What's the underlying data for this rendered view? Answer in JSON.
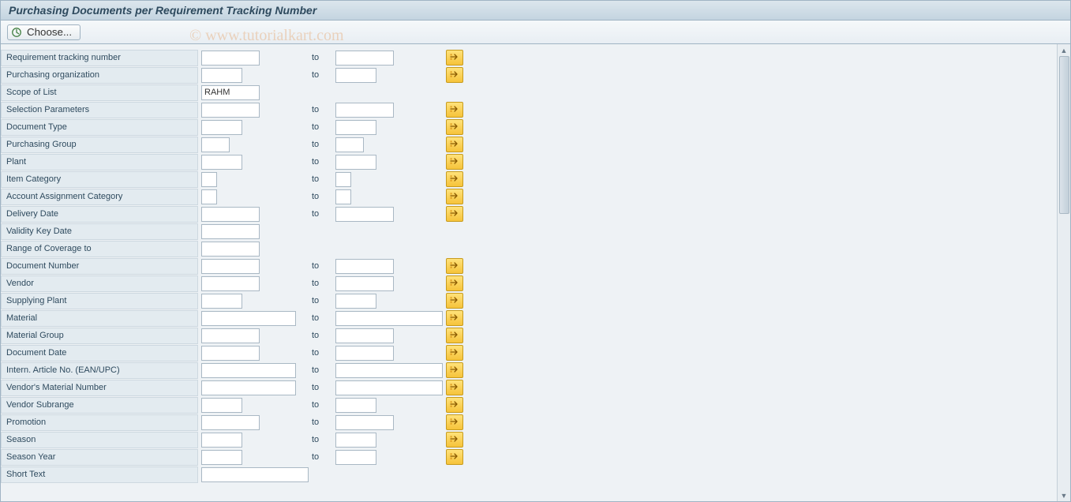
{
  "title": "Purchasing Documents per Requirement Tracking Number",
  "toolbar": {
    "choose_label": "Choose..."
  },
  "watermark": "© www.tutorialkart.com",
  "to_label": "to",
  "rows": [
    {
      "label": "Requirement tracking number",
      "from": "",
      "to": "",
      "hasTo": true,
      "hasMulti": true,
      "fromW": "w-md",
      "toW": "w-md"
    },
    {
      "label": "Purchasing organization",
      "from": "",
      "to": "",
      "hasTo": true,
      "hasMulti": true,
      "fromW": "w-sm",
      "toW": "w-sm"
    },
    {
      "label": "Scope of List",
      "from": "RAHM",
      "to": "",
      "hasTo": false,
      "hasMulti": false,
      "fromW": "w-md",
      "toW": ""
    },
    {
      "label": "Selection Parameters",
      "from": "",
      "to": "",
      "hasTo": true,
      "hasMulti": true,
      "fromW": "w-md",
      "toW": "w-md"
    },
    {
      "label": "Document Type",
      "from": "",
      "to": "",
      "hasTo": true,
      "hasMulti": true,
      "fromW": "w-sm",
      "toW": "w-sm"
    },
    {
      "label": "Purchasing Group",
      "from": "",
      "to": "",
      "hasTo": true,
      "hasMulti": true,
      "fromW": "w-xs",
      "toW": "w-xs"
    },
    {
      "label": "Plant",
      "from": "",
      "to": "",
      "hasTo": true,
      "hasMulti": true,
      "fromW": "w-sm",
      "toW": "w-sm"
    },
    {
      "label": "Item Category",
      "from": "",
      "to": "",
      "hasTo": true,
      "hasMulti": true,
      "fromW": "w-tiny",
      "toW": "w-tiny"
    },
    {
      "label": "Account Assignment Category",
      "from": "",
      "to": "",
      "hasTo": true,
      "hasMulti": true,
      "fromW": "w-tiny",
      "toW": "w-tiny"
    },
    {
      "label": "Delivery Date",
      "from": "",
      "to": "",
      "hasTo": true,
      "hasMulti": true,
      "fromW": "w-md",
      "toW": "w-md"
    },
    {
      "label": "Validity Key Date",
      "from": "",
      "to": "",
      "hasTo": false,
      "hasMulti": false,
      "fromW": "w-md",
      "toW": ""
    },
    {
      "label": "Range of Coverage to",
      "from": "",
      "to": "",
      "hasTo": false,
      "hasMulti": false,
      "fromW": "w-md",
      "toW": ""
    },
    {
      "label": "Document Number",
      "from": "",
      "to": "",
      "hasTo": true,
      "hasMulti": true,
      "fromW": "w-md",
      "toW": "w-md"
    },
    {
      "label": "Vendor",
      "from": "",
      "to": "",
      "hasTo": true,
      "hasMulti": true,
      "fromW": "w-md",
      "toW": "w-md"
    },
    {
      "label": "Supplying Plant",
      "from": "",
      "to": "",
      "hasTo": true,
      "hasMulti": true,
      "fromW": "w-sm",
      "toW": "w-sm"
    },
    {
      "label": "Material",
      "from": "",
      "to": "",
      "hasTo": true,
      "hasMulti": true,
      "fromW": "w-lg",
      "toW": "w-xl"
    },
    {
      "label": "Material Group",
      "from": "",
      "to": "",
      "hasTo": true,
      "hasMulti": true,
      "fromW": "w-md",
      "toW": "w-md"
    },
    {
      "label": "Document Date",
      "from": "",
      "to": "",
      "hasTo": true,
      "hasMulti": true,
      "fromW": "w-md",
      "toW": "w-md"
    },
    {
      "label": "Intern. Article No. (EAN/UPC)",
      "from": "",
      "to": "",
      "hasTo": true,
      "hasMulti": true,
      "fromW": "w-lg",
      "toW": "w-xl"
    },
    {
      "label": "Vendor's Material Number",
      "from": "",
      "to": "",
      "hasTo": true,
      "hasMulti": true,
      "fromW": "w-lg",
      "toW": "w-xl"
    },
    {
      "label": "Vendor Subrange",
      "from": "",
      "to": "",
      "hasTo": true,
      "hasMulti": true,
      "fromW": "w-sm",
      "toW": "w-sm"
    },
    {
      "label": "Promotion",
      "from": "",
      "to": "",
      "hasTo": true,
      "hasMulti": true,
      "fromW": "w-md",
      "toW": "w-md"
    },
    {
      "label": "Season",
      "from": "",
      "to": "",
      "hasTo": true,
      "hasMulti": true,
      "fromW": "w-sm",
      "toW": "w-sm"
    },
    {
      "label": "Season Year",
      "from": "",
      "to": "",
      "hasTo": true,
      "hasMulti": true,
      "fromW": "w-sm",
      "toW": "w-sm"
    },
    {
      "label": "Short Text",
      "from": "",
      "to": "",
      "hasTo": false,
      "hasMulti": false,
      "fromW": "w-xl",
      "toW": ""
    }
  ]
}
